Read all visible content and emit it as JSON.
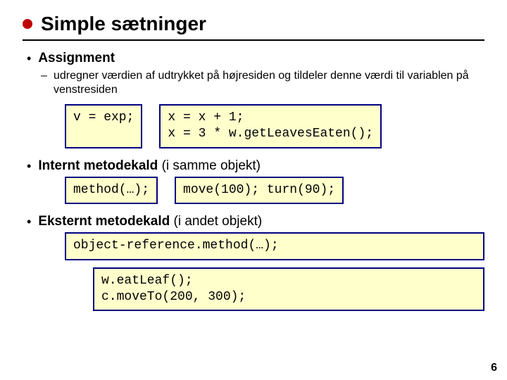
{
  "title": "Simple sætninger",
  "sections": {
    "assignment": {
      "heading": "Assignment",
      "sub": "udregner værdien af udtrykket på højresiden og tildeler denne værdi til variablen på venstresiden",
      "syntax": "v = exp;",
      "example": "x = x + 1;\nx = 3 * w.getLeavesEaten();"
    },
    "internal": {
      "heading_bold": "Internt metodekald",
      "heading_rest": " (i samme objekt)",
      "syntax": "method(…);",
      "example": "move(100); turn(90);"
    },
    "external": {
      "heading_bold": "Eksternt metodekald",
      "heading_rest": " (i andet objekt)",
      "syntax": "object-reference.method(…);",
      "example": "w.eatLeaf();\nc.moveTo(200, 300);"
    }
  },
  "page_number": "6"
}
